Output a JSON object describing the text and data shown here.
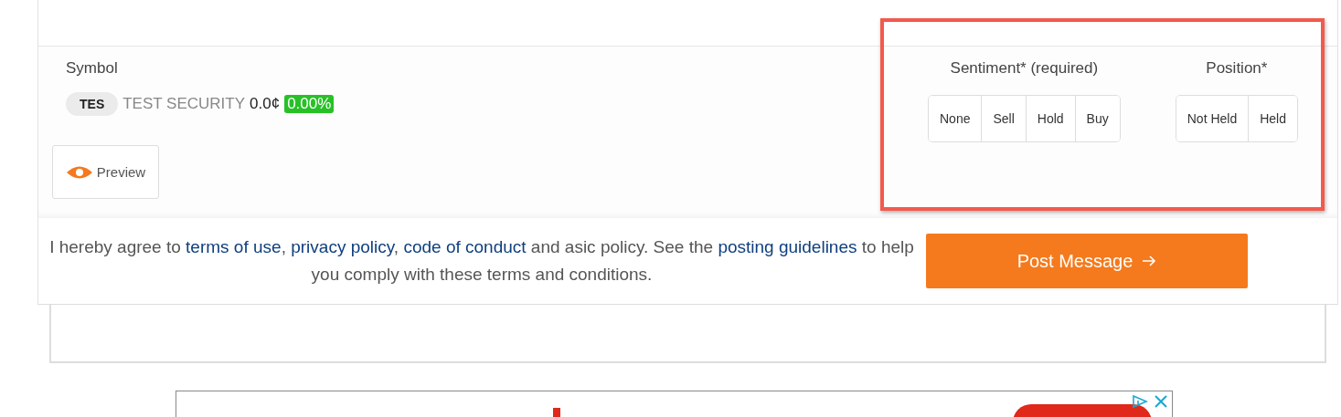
{
  "symbol": {
    "label": "Symbol",
    "ticker": "TES",
    "name": "TEST SECURITY",
    "price": "0.0¢",
    "change": "0.00%"
  },
  "preview_button": "Preview",
  "sentiment": {
    "label": "Sentiment* (required)",
    "options": [
      {
        "label": "None",
        "selected": false
      },
      {
        "label": "Sell",
        "selected": false
      },
      {
        "label": "Hold",
        "selected": false
      },
      {
        "label": "Buy",
        "selected": false
      }
    ]
  },
  "position": {
    "label": "Position*",
    "options": [
      {
        "label": "Not Held",
        "selected": false
      },
      {
        "label": "Held",
        "selected": false
      }
    ]
  },
  "agreement": [
    {
      "kind": "text",
      "text": "I hereby agree to "
    },
    {
      "kind": "link",
      "text": "terms of use"
    },
    {
      "kind": "text",
      "text": ", "
    },
    {
      "kind": "link",
      "text": "privacy policy"
    },
    {
      "kind": "text",
      "text": ", "
    },
    {
      "kind": "link",
      "text": "code of conduct"
    },
    {
      "kind": "text",
      "text": " and asic policy. See the "
    },
    {
      "kind": "link",
      "text": "posting guidelines"
    },
    {
      "kind": "text",
      "text": " to help you comply with these terms and conditions."
    }
  ],
  "post_button": "Post Message"
}
